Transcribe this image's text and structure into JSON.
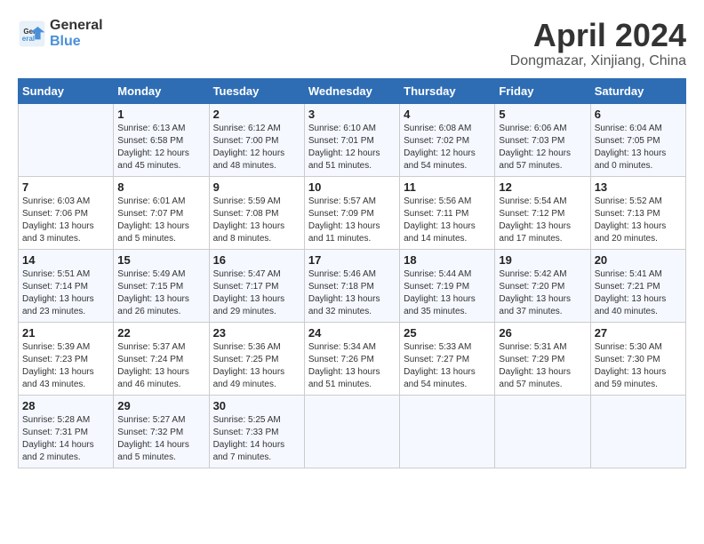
{
  "header": {
    "logo_line1": "General",
    "logo_line2": "Blue",
    "month": "April 2024",
    "location": "Dongmazar, Xinjiang, China"
  },
  "days_of_week": [
    "Sunday",
    "Monday",
    "Tuesday",
    "Wednesday",
    "Thursday",
    "Friday",
    "Saturday"
  ],
  "weeks": [
    [
      null,
      {
        "day": 1,
        "sunrise": "6:13 AM",
        "sunset": "6:58 PM",
        "daylight": "12 hours and 45 minutes."
      },
      {
        "day": 2,
        "sunrise": "6:12 AM",
        "sunset": "7:00 PM",
        "daylight": "12 hours and 48 minutes."
      },
      {
        "day": 3,
        "sunrise": "6:10 AM",
        "sunset": "7:01 PM",
        "daylight": "12 hours and 51 minutes."
      },
      {
        "day": 4,
        "sunrise": "6:08 AM",
        "sunset": "7:02 PM",
        "daylight": "12 hours and 54 minutes."
      },
      {
        "day": 5,
        "sunrise": "6:06 AM",
        "sunset": "7:03 PM",
        "daylight": "12 hours and 57 minutes."
      },
      {
        "day": 6,
        "sunrise": "6:04 AM",
        "sunset": "7:05 PM",
        "daylight": "13 hours and 0 minutes."
      }
    ],
    [
      {
        "day": 7,
        "sunrise": "6:03 AM",
        "sunset": "7:06 PM",
        "daylight": "13 hours and 3 minutes."
      },
      {
        "day": 8,
        "sunrise": "6:01 AM",
        "sunset": "7:07 PM",
        "daylight": "13 hours and 5 minutes."
      },
      {
        "day": 9,
        "sunrise": "5:59 AM",
        "sunset": "7:08 PM",
        "daylight": "13 hours and 8 minutes."
      },
      {
        "day": 10,
        "sunrise": "5:57 AM",
        "sunset": "7:09 PM",
        "daylight": "13 hours and 11 minutes."
      },
      {
        "day": 11,
        "sunrise": "5:56 AM",
        "sunset": "7:11 PM",
        "daylight": "13 hours and 14 minutes."
      },
      {
        "day": 12,
        "sunrise": "5:54 AM",
        "sunset": "7:12 PM",
        "daylight": "13 hours and 17 minutes."
      },
      {
        "day": 13,
        "sunrise": "5:52 AM",
        "sunset": "7:13 PM",
        "daylight": "13 hours and 20 minutes."
      }
    ],
    [
      {
        "day": 14,
        "sunrise": "5:51 AM",
        "sunset": "7:14 PM",
        "daylight": "13 hours and 23 minutes."
      },
      {
        "day": 15,
        "sunrise": "5:49 AM",
        "sunset": "7:15 PM",
        "daylight": "13 hours and 26 minutes."
      },
      {
        "day": 16,
        "sunrise": "5:47 AM",
        "sunset": "7:17 PM",
        "daylight": "13 hours and 29 minutes."
      },
      {
        "day": 17,
        "sunrise": "5:46 AM",
        "sunset": "7:18 PM",
        "daylight": "13 hours and 32 minutes."
      },
      {
        "day": 18,
        "sunrise": "5:44 AM",
        "sunset": "7:19 PM",
        "daylight": "13 hours and 35 minutes."
      },
      {
        "day": 19,
        "sunrise": "5:42 AM",
        "sunset": "7:20 PM",
        "daylight": "13 hours and 37 minutes."
      },
      {
        "day": 20,
        "sunrise": "5:41 AM",
        "sunset": "7:21 PM",
        "daylight": "13 hours and 40 minutes."
      }
    ],
    [
      {
        "day": 21,
        "sunrise": "5:39 AM",
        "sunset": "7:23 PM",
        "daylight": "13 hours and 43 minutes."
      },
      {
        "day": 22,
        "sunrise": "5:37 AM",
        "sunset": "7:24 PM",
        "daylight": "13 hours and 46 minutes."
      },
      {
        "day": 23,
        "sunrise": "5:36 AM",
        "sunset": "7:25 PM",
        "daylight": "13 hours and 49 minutes."
      },
      {
        "day": 24,
        "sunrise": "5:34 AM",
        "sunset": "7:26 PM",
        "daylight": "13 hours and 51 minutes."
      },
      {
        "day": 25,
        "sunrise": "5:33 AM",
        "sunset": "7:27 PM",
        "daylight": "13 hours and 54 minutes."
      },
      {
        "day": 26,
        "sunrise": "5:31 AM",
        "sunset": "7:29 PM",
        "daylight": "13 hours and 57 minutes."
      },
      {
        "day": 27,
        "sunrise": "5:30 AM",
        "sunset": "7:30 PM",
        "daylight": "13 hours and 59 minutes."
      }
    ],
    [
      {
        "day": 28,
        "sunrise": "5:28 AM",
        "sunset": "7:31 PM",
        "daylight": "14 hours and 2 minutes."
      },
      {
        "day": 29,
        "sunrise": "5:27 AM",
        "sunset": "7:32 PM",
        "daylight": "14 hours and 5 minutes."
      },
      {
        "day": 30,
        "sunrise": "5:25 AM",
        "sunset": "7:33 PM",
        "daylight": "14 hours and 7 minutes."
      },
      null,
      null,
      null,
      null
    ]
  ]
}
